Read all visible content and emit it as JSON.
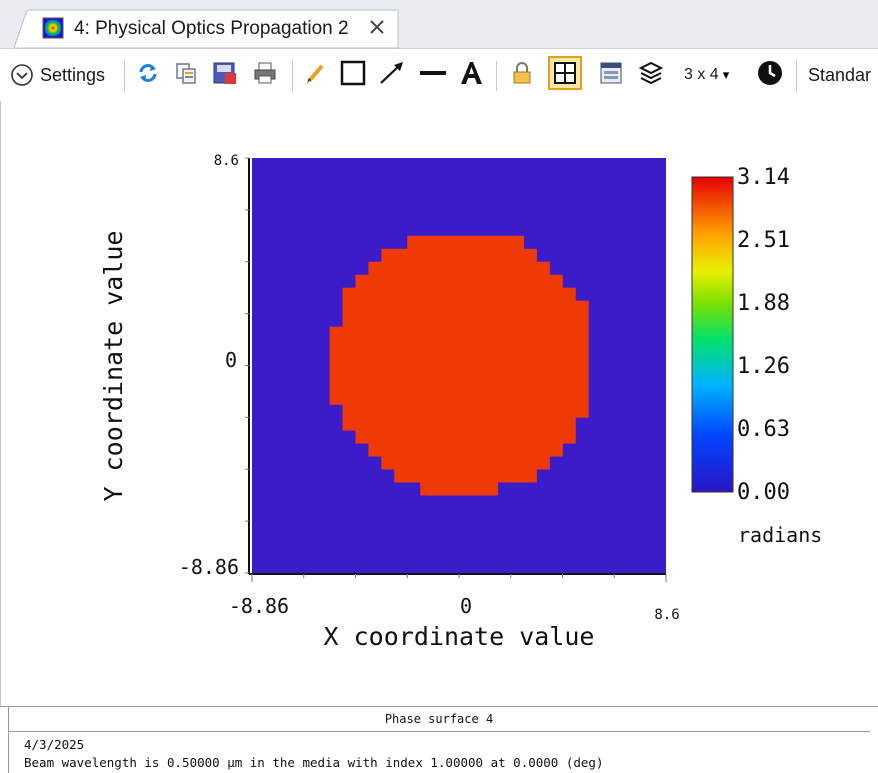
{
  "window": {
    "tab_title": "4: Physical Optics Propagation 2",
    "tab_icon": "phase-map-icon",
    "close_icon": "close-icon"
  },
  "toolbar": {
    "settings_label": "Settings",
    "layout_label": "3 x 4",
    "layout_arrow": "▾",
    "standard_label": "Standar",
    "icons": [
      "chevron-down-icon",
      "refresh-icon",
      "copy-icon",
      "save-image-icon",
      "print-icon",
      "pencil-icon",
      "rectangle-icon",
      "arrow-icon",
      "line-icon",
      "text-icon",
      "lock-icon",
      "grid-select-icon",
      "window-icon",
      "layers-icon",
      "clock-icon"
    ]
  },
  "plot": {
    "y_axis_label": "Y coordinate value",
    "x_axis_label": "X coordinate value",
    "y_top_label": "8.6",
    "y_mid_label": "0",
    "y_bottom_label": "-8.86",
    "x_left_label": "-8.86",
    "x_mid_label": "0",
    "x_right_label": "8.6",
    "background_color": "#3a1cc8",
    "circle_color": "#ef3a05"
  },
  "chart_data": {
    "type": "heatmap",
    "xlabel": "X coordinate value",
    "ylabel": "Y coordinate value",
    "xlim": [
      -8.86,
      8.6
    ],
    "ylim": [
      -8.86,
      8.6
    ],
    "value_outside": 0.0,
    "value_inside": 2.95,
    "circle_radius": 5.6,
    "colorbar": {
      "ticks": [
        "3.14",
        "2.51",
        "1.88",
        "1.26",
        "0.63",
        "0.00"
      ],
      "min": 0.0,
      "max": 3.14,
      "unit_label": "radians"
    }
  },
  "footer": {
    "title": "Phase surface 4",
    "date": "4/3/2025",
    "info_line": "Beam wavelength is 0.50000 µm in the media with index 1.00000 at 0.0000 (deg)"
  }
}
